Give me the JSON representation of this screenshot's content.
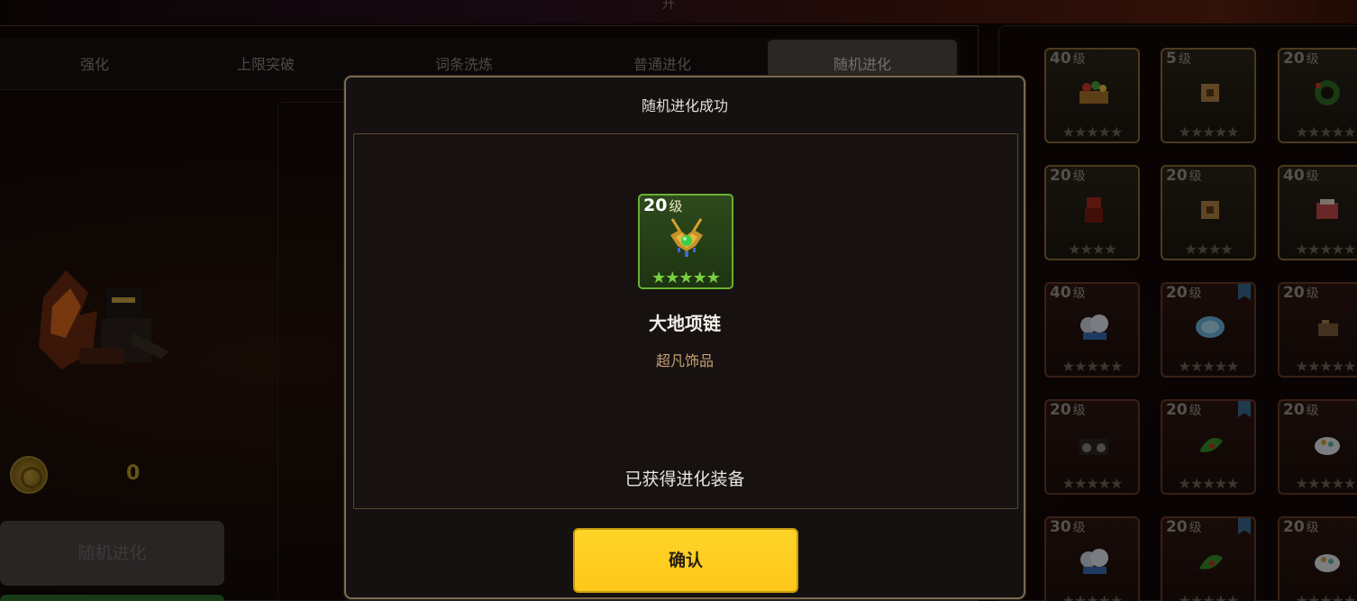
{
  "background": {
    "top_title_peek": "升",
    "tabs": [
      {
        "label": "强化",
        "active": false
      },
      {
        "label": "上限突破",
        "active": false
      },
      {
        "label": "词条洗炼",
        "active": false
      },
      {
        "label": "普通进化",
        "active": false
      },
      {
        "label": "随机进化",
        "active": true
      }
    ],
    "coin": {
      "icon": "coin-icon",
      "value": "0"
    },
    "evolve_button_label": "随机进化"
  },
  "inventory": {
    "slots": [
      {
        "level": "40",
        "unit": "级",
        "stars": "★★★★★",
        "icon": "basket-icon"
      },
      {
        "level": "5",
        "unit": "级",
        "stars": "★★★★★",
        "icon": "box-icon"
      },
      {
        "level": "20",
        "unit": "级",
        "stars": "★★★★★",
        "icon": "wreath-icon"
      },
      {
        "level": "20",
        "unit": "级",
        "stars": "★★★★",
        "icon": "figure-icon"
      },
      {
        "level": "20",
        "unit": "级",
        "stars": "★★★★",
        "icon": "box-icon"
      },
      {
        "level": "40",
        "unit": "级",
        "stars": "★★★★★",
        "icon": "bag-icon"
      },
      {
        "level": "40",
        "unit": "级",
        "stars": "★★★★★",
        "icon": "cloud-icon"
      },
      {
        "level": "20",
        "unit": "级",
        "stars": "★★★★★",
        "icon": "shell-icon",
        "flag": true
      },
      {
        "level": "20",
        "unit": "级",
        "stars": "★★★★★",
        "icon": "chest-icon"
      },
      {
        "level": "20",
        "unit": "级",
        "stars": "★★★★★",
        "icon": "radio-icon"
      },
      {
        "level": "20",
        "unit": "级",
        "stars": "★★★★★",
        "icon": "leaf-icon",
        "flag": true
      },
      {
        "level": "20",
        "unit": "级",
        "stars": "★★★★★",
        "icon": "bowl-icon"
      },
      {
        "level": "30",
        "unit": "级",
        "stars": "★★★★★",
        "icon": "cloud-icon"
      },
      {
        "level": "20",
        "unit": "级",
        "stars": "★★★★★",
        "icon": "leaf-icon",
        "flag": true
      },
      {
        "level": "20",
        "unit": "级",
        "stars": "★★★★★",
        "icon": "bowl-icon"
      }
    ]
  },
  "modal": {
    "title": "随机进化成功",
    "reward": {
      "level": "20",
      "unit": "级",
      "stars": "★★★★★",
      "icon": "necklace-icon",
      "name": "大地项链",
      "rarity": "超凡饰品"
    },
    "message": "已获得进化装备",
    "confirm_label": "确认"
  },
  "colors": {
    "confirm_button": "#FFCC22",
    "reward_border": "#6AB030",
    "rarity_text": "#C8A070",
    "coin_value": "#B8962A"
  }
}
